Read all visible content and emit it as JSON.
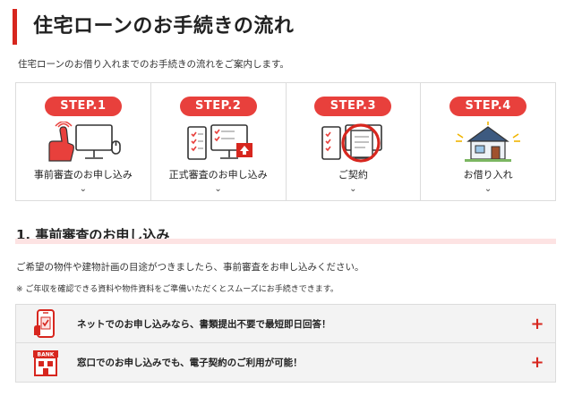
{
  "page": {
    "title": "住宅ローンのお手続きの流れ",
    "intro": "住宅ローンのお借り入れまでのお手続きの流れをご案内します。"
  },
  "steps": [
    {
      "badge": "STEP.1",
      "label": "事前審査のお申し込み",
      "chevron": "⌄",
      "icon": "hand-touch-desktop-icon"
    },
    {
      "badge": "STEP.2",
      "label": "正式審査のお申し込み",
      "chevron": "⌄",
      "icon": "document-upload-icon"
    },
    {
      "badge": "STEP.3",
      "label": "ご契約",
      "chevron": "⌄",
      "icon": "contract-check-icon"
    },
    {
      "badge": "STEP.4",
      "label": "お借り入れ",
      "chevron": "⌄",
      "icon": "house-icon"
    }
  ],
  "section": {
    "title": "1.  事前審査のお申し込み",
    "text": "ご希望の物件や建物計画の目途がつきましたら、事前審査をお申し込みください。",
    "note": "※ ご年収を確認できる資料や物件資料をご準備いただくとスムーズにお手続きできます。"
  },
  "accordions": [
    {
      "icon": "smartphone-icon",
      "text": "ネットでのお申し込みなら、書類提出不要で最短即日回答！",
      "toggle": "+"
    },
    {
      "icon": "bank-icon",
      "bank_label": "BANK",
      "text": "窓口でのお申し込みでも、電子契約のご利用が可能！",
      "toggle": "+"
    }
  ],
  "colors": {
    "accent": "#d7261e",
    "badge": "#e8403c",
    "underline": "#fde3e3"
  }
}
